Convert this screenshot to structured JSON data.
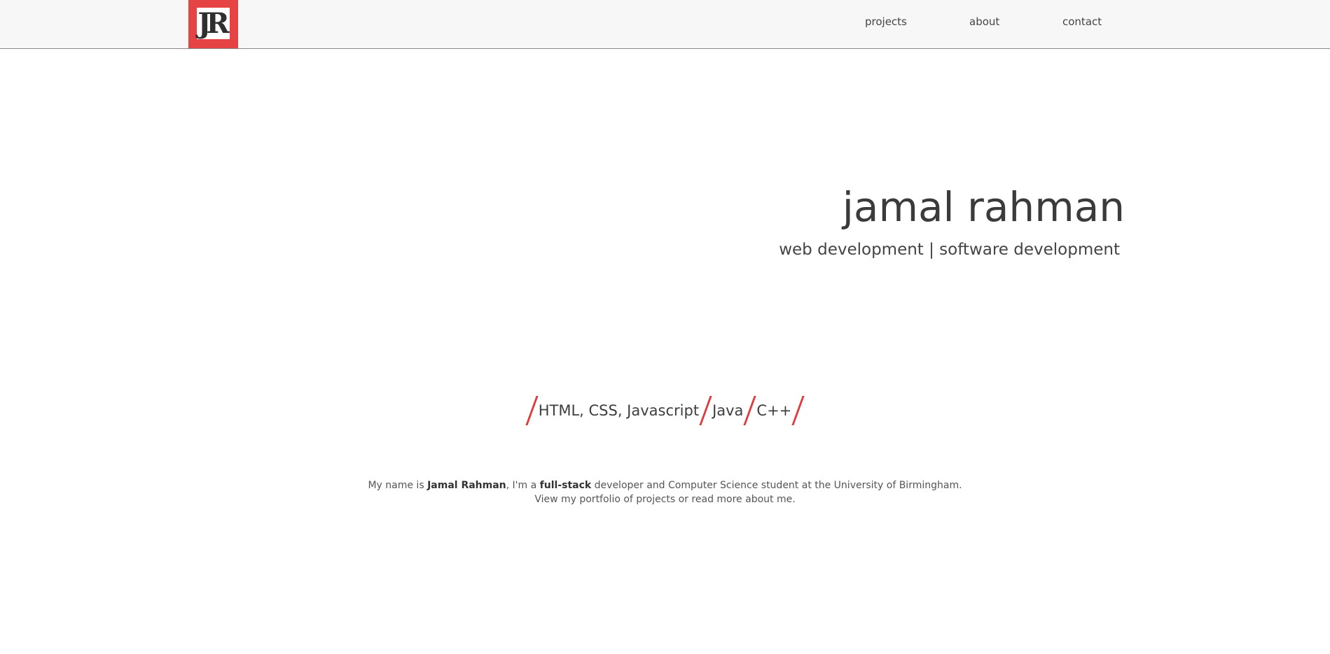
{
  "brand": {
    "logo_text": "JR",
    "accent_color": "#e64444"
  },
  "nav": {
    "projects": "projects",
    "about": "about",
    "contact": "contact"
  },
  "hero": {
    "name": "jamal rahman",
    "subtitle": "web development | software development"
  },
  "skills": [
    "HTML, CSS, Javascript",
    "Java",
    "C++"
  ],
  "intro": {
    "line1_prefix": "My name is ",
    "name": "Jamal Rahman",
    "line1_middle": ", I'm a ",
    "highlight": "full-stack",
    "line1_suffix": " developer and Computer Science student at the University of Birmingham.",
    "line2_prefix": "View my ",
    "portfolio_link": "portfolio of projects",
    "line2_middle": " or ",
    "about_link": "read more about me",
    "line2_suffix": "."
  }
}
